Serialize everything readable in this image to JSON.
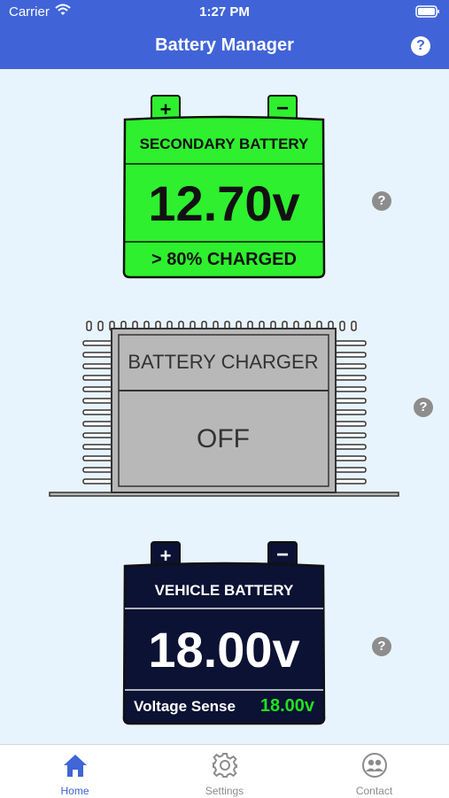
{
  "status_bar": {
    "carrier": "Carrier",
    "time": "1:27 PM"
  },
  "nav": {
    "title": "Battery Manager",
    "help_symbol": "?"
  },
  "secondary_battery": {
    "title": "SECONDARY BATTERY",
    "voltage": "12.70v",
    "status": "> 80% CHARGED",
    "plus": "+",
    "minus": "−",
    "fill_color": "#2ef02e",
    "help_symbol": "?"
  },
  "charger": {
    "title": "BATTERY CHARGER",
    "state": "OFF",
    "fill_color": "#b8b8b8",
    "help_symbol": "?"
  },
  "vehicle_battery": {
    "title": "VEHICLE BATTERY",
    "voltage": "18.00v",
    "sense_label": "Voltage Sense",
    "sense_value": "18.00v",
    "sense_color": "#22e022",
    "plus": "+",
    "minus": "−",
    "fill_color": "#0b1233",
    "help_symbol": "?"
  },
  "tabs": [
    {
      "label": "Home",
      "icon": "home-icon",
      "active": true
    },
    {
      "label": "Settings",
      "icon": "gear-icon",
      "active": false
    },
    {
      "label": "Contact",
      "icon": "contact-icon",
      "active": false
    }
  ],
  "colors": {
    "accent": "#4064d8",
    "background": "#e8f4fd",
    "tab_active": "#3f65d6"
  }
}
